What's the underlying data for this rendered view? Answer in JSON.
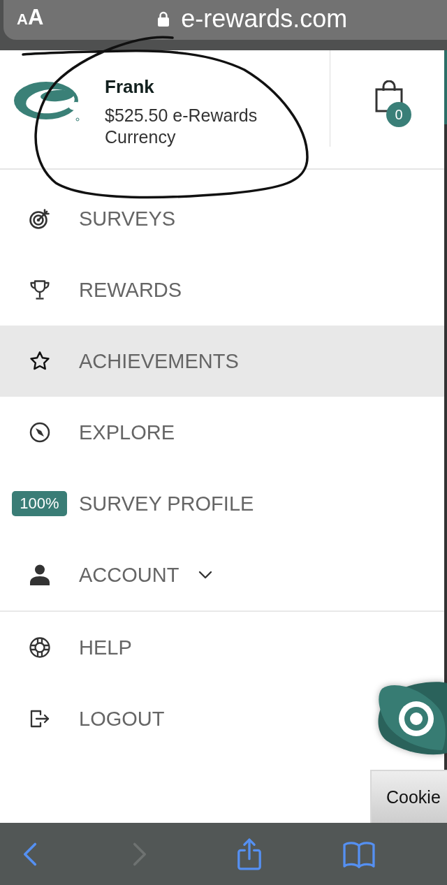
{
  "browser_bar": {
    "text_size_button": "AA",
    "secure": true,
    "url": "e-rewards.com"
  },
  "account": {
    "name": "Frank",
    "balance": "$525.50 e-Rewards Currency",
    "cart_count": "0"
  },
  "menu": {
    "sections": [
      {
        "items": [
          {
            "kind": "link",
            "label": "SURVEYS",
            "selected": false
          },
          {
            "kind": "link",
            "label": "REWARDS",
            "selected": false
          },
          {
            "kind": "link",
            "label": "ACHIEVEMENTS",
            "selected": true
          },
          {
            "kind": "link",
            "label": "EXPLORE",
            "selected": false
          },
          {
            "kind": "badge",
            "badge": "100%",
            "label": "SURVEY PROFILE",
            "selected": false
          },
          {
            "kind": "dropdown",
            "label": "ACCOUNT",
            "expanded": false,
            "selected": false
          }
        ]
      },
      {
        "items": [
          {
            "kind": "link",
            "label": "HELP",
            "selected": false
          },
          {
            "kind": "link",
            "label": "LOGOUT",
            "selected": false
          }
        ]
      }
    ]
  },
  "cookie_button": "Cookie",
  "toolbar": {
    "buttons": [
      {
        "kind": "back",
        "disabled": false
      },
      {
        "kind": "forward",
        "disabled": true
      },
      {
        "kind": "share",
        "disabled": false
      },
      {
        "kind": "bookmarks",
        "disabled": false
      }
    ]
  }
}
